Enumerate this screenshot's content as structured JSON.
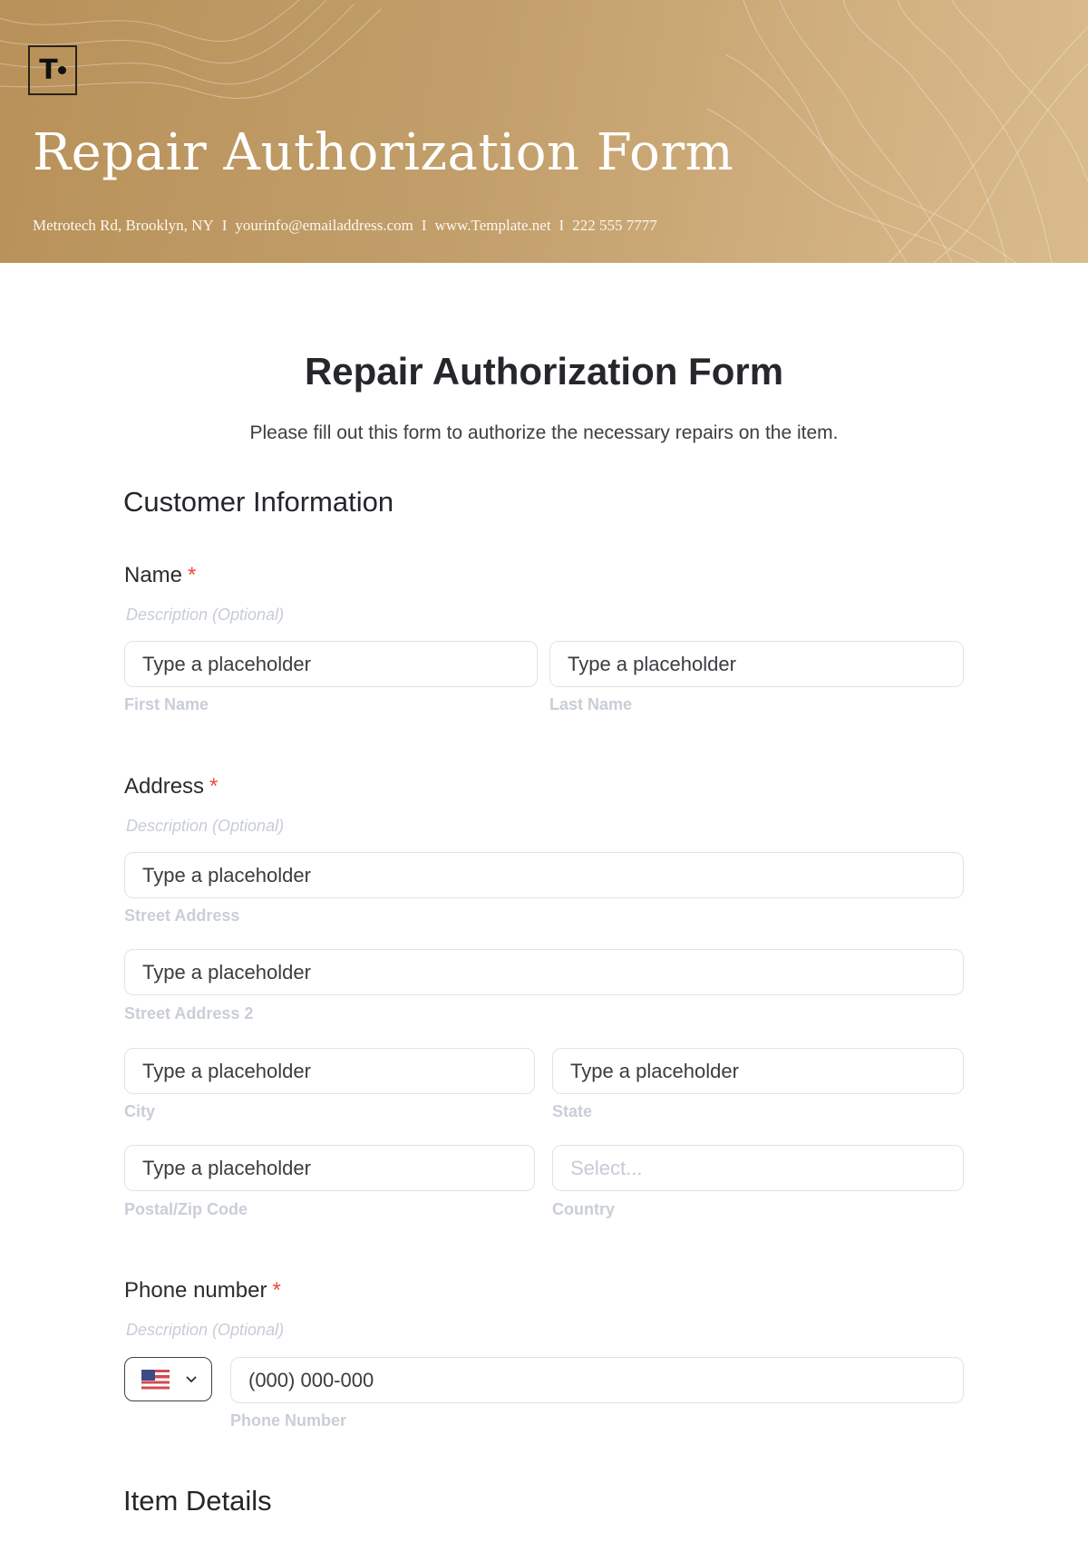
{
  "header": {
    "logo_text": "T",
    "title": "Repair Authorization Form",
    "contact": {
      "address": "Metrotech Rd, Brooklyn, NY",
      "email": "yourinfo@emailaddress.com",
      "website": "www.Template.net",
      "phone": "222 555 7777",
      "separator": "I"
    }
  },
  "form": {
    "title": "Repair Authorization Form",
    "subtitle": "Please fill out this form to authorize the necessary repairs on the item.",
    "sections": [
      {
        "title": "Customer Information"
      },
      {
        "title": "Item Details"
      }
    ],
    "required_marker": "*",
    "description_placeholder": "Description (Optional)",
    "fields": {
      "name": {
        "label": "Name",
        "first": {
          "placeholder": "Type a placeholder",
          "sublabel": "First Name"
        },
        "last": {
          "placeholder": "Type a placeholder",
          "sublabel": "Last Name"
        }
      },
      "address": {
        "label": "Address",
        "street": {
          "placeholder": "Type a placeholder",
          "sublabel": "Street Address"
        },
        "street2": {
          "placeholder": "Type a placeholder",
          "sublabel": "Street Address 2"
        },
        "city": {
          "placeholder": "Type a placeholder",
          "sublabel": "City"
        },
        "state": {
          "placeholder": "Type a placeholder",
          "sublabel": "State"
        },
        "postal": {
          "placeholder": "Type a placeholder",
          "sublabel": "Postal/Zip Code"
        },
        "country": {
          "placeholder": "Select...",
          "sublabel": "Country"
        }
      },
      "phone": {
        "label": "Phone number",
        "country_flag": "us-flag-icon",
        "placeholder": "(000) 000-000",
        "sublabel": "Phone Number"
      }
    }
  },
  "colors": {
    "header_gold": "#c29f6b",
    "required_red": "#ef4a3c",
    "input_border": "#dfe3ea",
    "muted_text": "#c9ced7"
  }
}
